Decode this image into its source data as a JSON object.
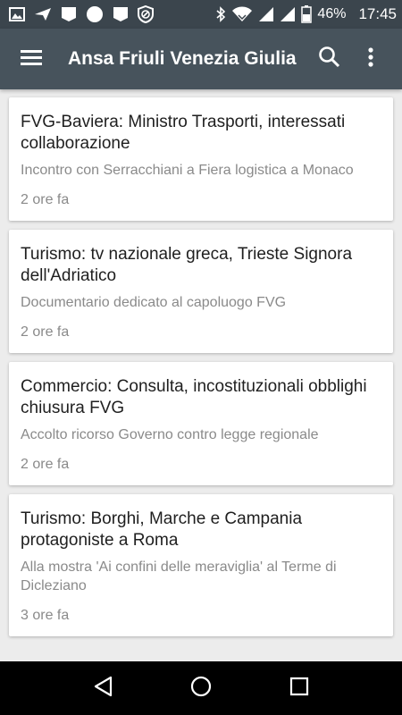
{
  "status_bar": {
    "battery": "46%",
    "time": "17:45"
  },
  "app_bar": {
    "title": "Ansa Friuli Venezia Giulia",
    "menu_icon": "menu-icon",
    "search_icon": "search-icon",
    "more_icon": "more-vert-icon"
  },
  "articles": [
    {
      "headline": "FVG-Baviera: Ministro Trasporti, interessati collaborazione",
      "summary": "Incontro con Serracchiani a Fiera logistica a Monaco",
      "time": "2 ore fa"
    },
    {
      "headline": "Turismo: tv nazionale greca, Trieste Signora dell'Adriatico",
      "summary": "Documentario dedicato al capoluogo FVG",
      "time": "2 ore fa"
    },
    {
      "headline": "Commercio: Consulta, incostituzionali obblighi chiusura FVG",
      "summary": "Accolto ricorso Governo contro legge regionale",
      "time": "2 ore fa"
    },
    {
      "headline": "Turismo: Borghi, Marche e Campania protagoniste a Roma",
      "summary": "Alla mostra 'Ai confini delle meraviglia' al Terme di Dicleziano",
      "time": "3 ore fa"
    }
  ],
  "colors": {
    "status_bar": "#3b454d",
    "app_bar": "#47535c",
    "background": "#ececec"
  }
}
